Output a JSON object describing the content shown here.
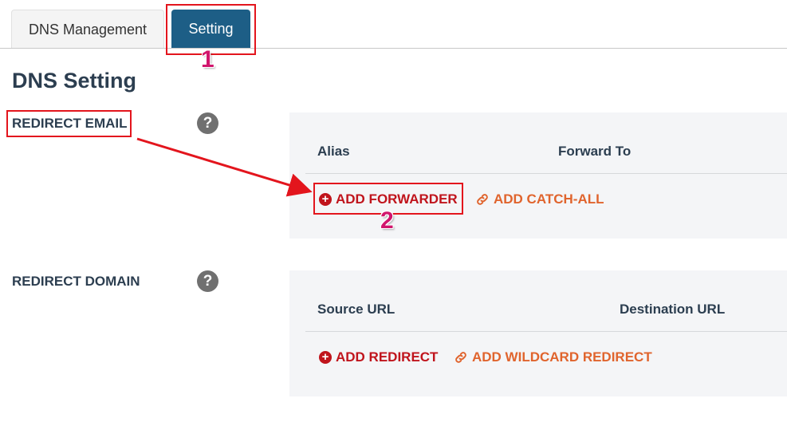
{
  "tabs": {
    "dns_management": "DNS Management",
    "setting": "Setting"
  },
  "page_title": "DNS Setting",
  "redirect_email": {
    "label": "REDIRECT EMAIL",
    "help": "?",
    "columns": {
      "alias": "Alias",
      "forward_to": "Forward To"
    },
    "add_forwarder": "ADD FORWARDER",
    "add_catch_all": "ADD CATCH-ALL"
  },
  "redirect_domain": {
    "label": "REDIRECT DOMAIN",
    "help": "?",
    "columns": {
      "source_url": "Source URL",
      "destination_url": "Destination URL"
    },
    "add_redirect": "ADD REDIRECT",
    "add_wildcard_redirect": "ADD WILDCARD REDIRECT"
  },
  "annotations": {
    "step1": "1",
    "step2": "2"
  },
  "colors": {
    "tab_active": "#1d5e86",
    "highlight": "#e3151d",
    "step_number": "#d1166d",
    "action_red": "#c0141c",
    "action_orange": "#e0642d"
  }
}
